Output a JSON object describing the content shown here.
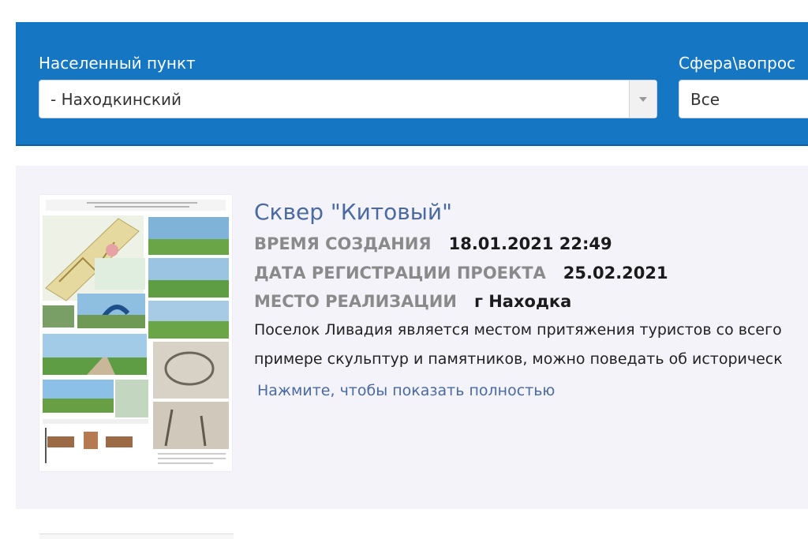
{
  "filters": {
    "locality": {
      "label": "Населенный пункт",
      "value": "- Находкинский"
    },
    "sphere": {
      "label": "Сфера\\вопрос",
      "value": "Все"
    }
  },
  "project": {
    "title": "Сквер \"Китовый\"",
    "created_label": "ВРЕМЯ СОЗДАНИЯ",
    "created_value": "18.01.2021 22:49",
    "registered_label": "ДАТА РЕГИСТРАЦИИ ПРОЕКТА",
    "registered_value": "25.02.2021",
    "place_label": "МЕСТО РЕАЛИЗАЦИИ",
    "place_value": "г Находка",
    "description_line1": "Поселок Ливадия является местом притяжения туристов со всего",
    "description_line2": "примере скульптур и памятников, можно поведать об историческ",
    "show_more": "Нажмите, чтобы показать полностью"
  },
  "colors": {
    "filter_bar": "#1576c4",
    "card_bg": "#f3f3f9",
    "title_link": "#4a6aa1",
    "meta_label": "#8a8a8a"
  }
}
